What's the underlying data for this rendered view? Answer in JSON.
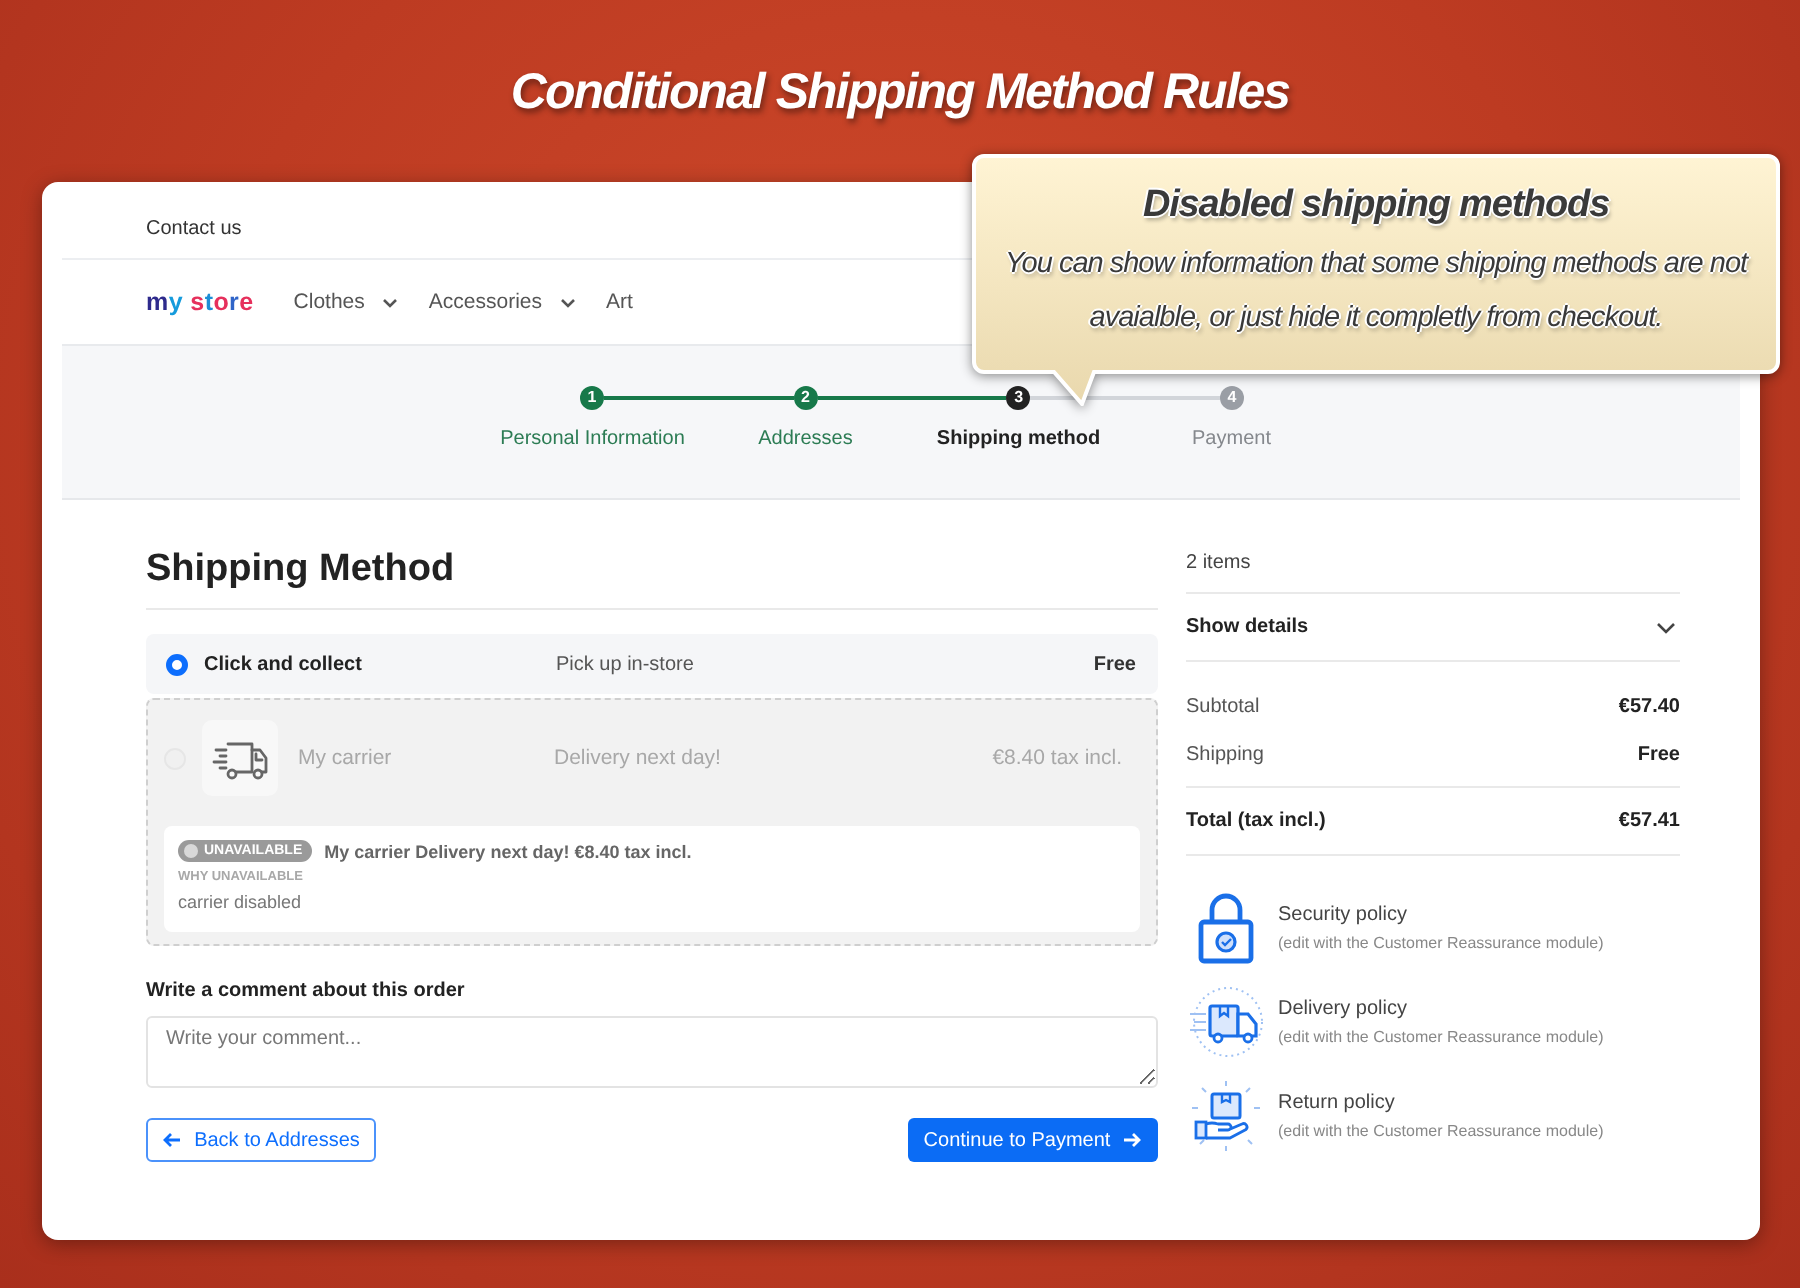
{
  "banner": {
    "title": "Conditional Shipping Method Rules"
  },
  "callout": {
    "title": "Disabled shipping methods",
    "text": "You can show information that some shipping methods are not avaialble, or just hide it completly from checkout."
  },
  "header": {
    "contact_link": "Contact us",
    "logo": "my store",
    "menu": [
      {
        "label": "Clothes",
        "has_dropdown": true
      },
      {
        "label": "Accessories",
        "has_dropdown": true
      },
      {
        "label": "Art",
        "has_dropdown": false
      }
    ]
  },
  "steps": [
    {
      "number": "1",
      "label": "Personal Information",
      "completed": true,
      "selected": false
    },
    {
      "number": "2",
      "label": "Addresses",
      "completed": true,
      "selected": false
    },
    {
      "number": "3",
      "label": "Shipping method",
      "completed": false,
      "selected": true
    },
    {
      "number": "4",
      "label": "Payment",
      "completed": false,
      "selected": false
    }
  ],
  "shipping": {
    "title": "Shipping Method",
    "options": [
      {
        "selected": true,
        "disabled": false,
        "has_logo": false,
        "name": "Click and collect",
        "description": "Pick up in-store",
        "price": "Free"
      },
      {
        "selected": false,
        "disabled": true,
        "has_logo": true,
        "name": "My carrier",
        "description": "Delivery next day!",
        "price": "€8.40 tax incl.",
        "notice": {
          "badge": "UNAVAILABLE",
          "summary": "My carrier Delivery next day! €8.40 tax incl.",
          "reason_label": "WHY UNAVAILABLE",
          "reason": "carrier disabled"
        }
      }
    ]
  },
  "comment": {
    "label": "Write a comment about this order",
    "placeholder": "Write your comment..."
  },
  "buttons": [
    {
      "kind": "back",
      "label": "Back to Addresses"
    },
    {
      "kind": "continue",
      "label": "Continue to Payment"
    }
  ],
  "summary": {
    "items_count": "2 items",
    "details_toggle": {
      "label": "Show details",
      "expanded": false
    },
    "lines": [
      {
        "label": "Subtotal",
        "value": "€57.40"
      },
      {
        "label": "Shipping",
        "value": "Free"
      }
    ],
    "total": {
      "label": "Total (tax incl.)",
      "value": "€57.41"
    }
  },
  "reassurance": [
    {
      "kind": "security",
      "title": "Security policy",
      "note": "(edit with the Customer Reassurance module)"
    },
    {
      "kind": "delivery",
      "title": "Delivery policy",
      "note": "(edit with the Customer Reassurance module)"
    },
    {
      "kind": "return",
      "title": "Return policy",
      "note": "(edit with the Customer Reassurance module)"
    }
  ]
}
